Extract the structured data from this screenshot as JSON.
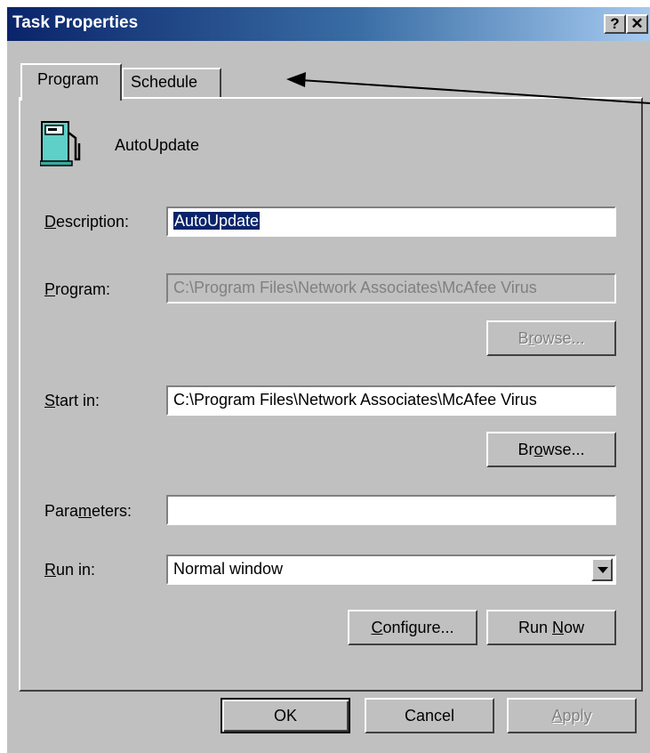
{
  "window": {
    "title": "Task Properties",
    "help_label": "?",
    "close_label": "✕"
  },
  "tabs": [
    {
      "label": "Program",
      "active": true
    },
    {
      "label": "Schedule",
      "active": false
    }
  ],
  "task": {
    "icon": "gas-pump-icon",
    "name": "AutoUpdate"
  },
  "description": {
    "label_hotkey": "D",
    "label_rest": "escription:",
    "value": "AutoUpdate"
  },
  "program": {
    "label_hotkey": "P",
    "label_rest": "rogram:",
    "value": "C:\\Program Files\\Network Associates\\McAfee Virus",
    "browse_pre": "B",
    "browse_hotkey": "r",
    "browse_post": "owse..."
  },
  "start_in": {
    "label_hotkey": "S",
    "label_rest": "tart in:",
    "value": "C:\\Program Files\\Network Associates\\McAfee Virus",
    "browse_pre": "Br",
    "browse_hotkey": "o",
    "browse_post": "wse..."
  },
  "parameters": {
    "label_pre": "Para",
    "label_hotkey": "m",
    "label_post": "eters:",
    "value": ""
  },
  "run_in": {
    "label_hotkey": "R",
    "label_rest": "un in:",
    "value": "Normal window"
  },
  "actions": {
    "configure_hotkey": "C",
    "configure_rest": "onfigure...",
    "run_now_pre": "Run ",
    "run_now_hotkey": "N",
    "run_now_post": "ow"
  },
  "footer": {
    "ok": "OK",
    "cancel": "Cancel",
    "apply_hotkey": "A",
    "apply_rest": "pply"
  }
}
